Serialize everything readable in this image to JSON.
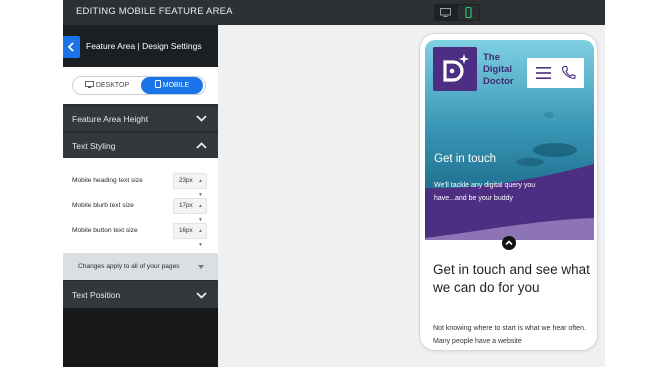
{
  "topbar": {
    "title": "EDITING MOBILE FEATURE AREA",
    "desktop_icon": "desktop-icon",
    "mobile_icon": "mobile-icon"
  },
  "sidebar": {
    "back_icon": "chevron-left-icon",
    "title": "Feature Area | Design Settings",
    "view_toggle": {
      "desktop_label": "DESKTOP",
      "mobile_label": "MOBILE",
      "selected": "MOBILE"
    },
    "sections": [
      {
        "label": "Feature Area Height",
        "state": "collapsed"
      },
      {
        "label": "Text Styling",
        "state": "expanded"
      },
      {
        "label": "Text Position",
        "state": "collapsed"
      }
    ],
    "text_styling": {
      "rows": [
        {
          "label": "Mobile heading text size",
          "value": "23px"
        },
        {
          "label": "Mobile blurb text size",
          "value": "17px"
        },
        {
          "label": "Mobile button text size",
          "value": "16px"
        }
      ]
    },
    "note": "Changes apply to all of your pages",
    "accent_color": "#1a73e8"
  },
  "preview": {
    "brand": {
      "line1": "The",
      "line2": "Digital",
      "line3": "Doctor"
    },
    "icons": {
      "menu": "hamburger-icon",
      "phone": "phone-icon",
      "scroll": "chevron-up-icon"
    },
    "hero_heading": "Get in touch",
    "hero_sub_line1": "We'll tackle any digital query you",
    "hero_sub_line2": "have...and be your buddy",
    "content_heading": "Get in touch and see what we can do for you",
    "content_text": "Not knowing where to start is what we hear often. Many people have a website",
    "brand_color": "#4d2e83"
  }
}
